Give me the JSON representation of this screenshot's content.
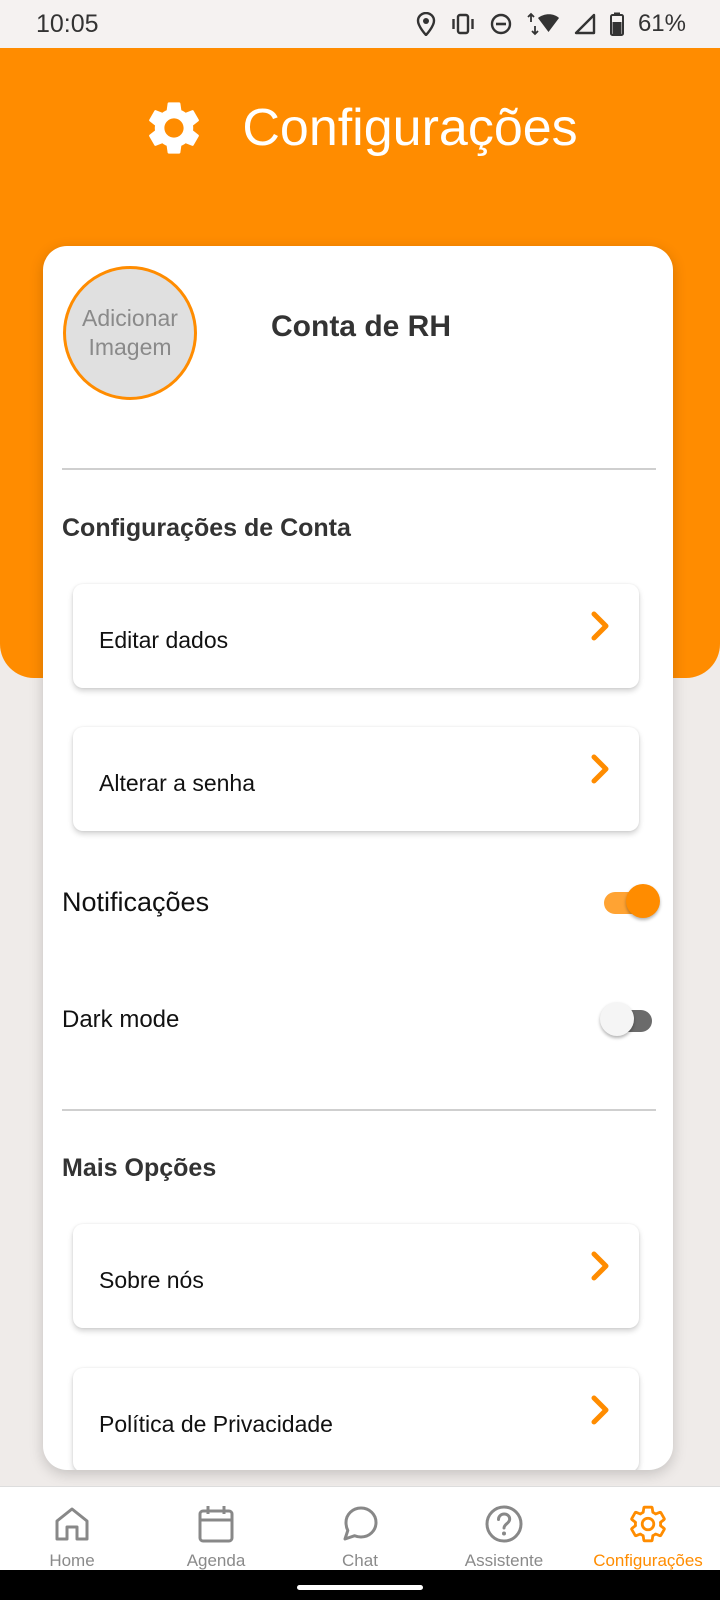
{
  "status_bar": {
    "time": "10:05",
    "battery": "61%",
    "icons": [
      "location-icon",
      "vibrate-icon",
      "dnd-icon",
      "wifi-icon",
      "signal-icon",
      "battery-icon"
    ]
  },
  "header": {
    "title": "Configurações",
    "icon": "gear-icon",
    "color": "#ff8c00"
  },
  "profile": {
    "avatar_text": "Adicionar Imagem",
    "name": "Conta de RH"
  },
  "account_section": {
    "title": "Configurações de Conta",
    "items": [
      {
        "label": "Editar dados"
      },
      {
        "label": "Alterar a senha"
      }
    ]
  },
  "toggles": {
    "notifications": {
      "label": "Notificações",
      "on": true
    },
    "dark_mode": {
      "label": "Dark mode",
      "on": false
    }
  },
  "more_section": {
    "title": "Mais Opções",
    "items": [
      {
        "label": "Sobre nós"
      },
      {
        "label": "Política de Privacidade"
      }
    ]
  },
  "bottom_nav": {
    "items": [
      {
        "label": "Home",
        "icon": "home-icon",
        "active": false
      },
      {
        "label": "Agenda",
        "icon": "calendar-icon",
        "active": false
      },
      {
        "label": "Chat",
        "icon": "chat-icon",
        "active": false
      },
      {
        "label": "Assistente",
        "icon": "help-icon",
        "active": false
      },
      {
        "label": "Configurações",
        "icon": "gear-icon",
        "active": true
      }
    ]
  }
}
